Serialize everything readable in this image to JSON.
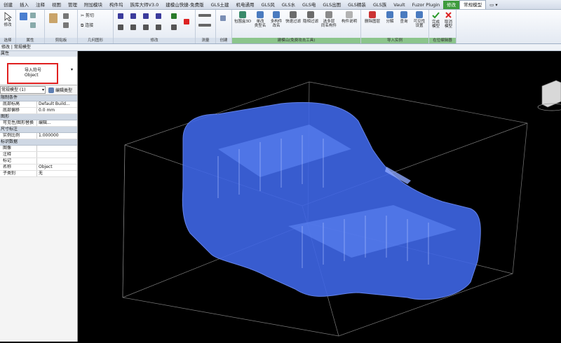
{
  "menubar": {
    "tabs": [
      "创建",
      "插入",
      "注释",
      "视图",
      "管理",
      "附加模块",
      "构件坞",
      "族库大师V3.0",
      "建模山快捷-免费版",
      "GLS土建",
      "机电通用",
      "GLS风",
      "GLS水",
      "GLS电",
      "GLS出图",
      "GLS精装",
      "GLS族",
      "Vault",
      "Fuzor Plugin",
      "修改",
      "常规模型"
    ],
    "extra": "▭ ▾"
  },
  "ribbon": {
    "select_label": "选择",
    "modify_label": "修改",
    "panels": [
      "属性",
      "剪贴板",
      "几何图形",
      "修改",
      "测量",
      "创建",
      "建模山(免费攻击工具)",
      "导入实例",
      "在位编辑器"
    ],
    "buttons": {
      "cut": "剪切",
      "join": "连接",
      "bbox3d": "包围盒3D",
      "single_rename": "单改\n类型名",
      "multi_rename": "多构件\n改名",
      "quick_filter": "快速过滤",
      "hide_filter": "隐相过滤",
      "select_multi": "选多层\n同名构件",
      "component_info": "构件说明",
      "delete_layer": "删除图层",
      "explode": "分解",
      "query": "查询",
      "visibility": "可见性\n设置",
      "finish_model": "完成\n模型",
      "cancel_model": "取消\n模型"
    }
  },
  "addressbar": {
    "text": "修改 | 常规模型"
  },
  "properties": {
    "title": "属性",
    "symbol_label": "导入符号",
    "symbol_value": "Object",
    "type_selector": "常规模型 (1)",
    "edit_type": "编辑类型",
    "groups": [
      {
        "name": "限制条件",
        "rows": [
          {
            "k": "底部标高",
            "v": "Default Build..."
          },
          {
            "k": "底部偏移",
            "v": "0.0 mm"
          }
        ]
      },
      {
        "name": "图形",
        "rows": [
          {
            "k": "可见性/图形替换",
            "v": "编辑..."
          }
        ]
      },
      {
        "name": "尺寸标注",
        "rows": [
          {
            "k": "实例比例",
            "v": "1.000000"
          }
        ]
      },
      {
        "name": "标识数据",
        "rows": [
          {
            "k": "图像",
            "v": ""
          },
          {
            "k": "注释",
            "v": ""
          },
          {
            "k": "标记",
            "v": ""
          },
          {
            "k": "名称",
            "v": "Object"
          },
          {
            "k": "子类别",
            "v": "无"
          }
        ]
      }
    ]
  },
  "colors": {
    "model_fill": "#3f66e6",
    "accent_green": "#3d9b3d",
    "highlight_red": "#e02020"
  }
}
